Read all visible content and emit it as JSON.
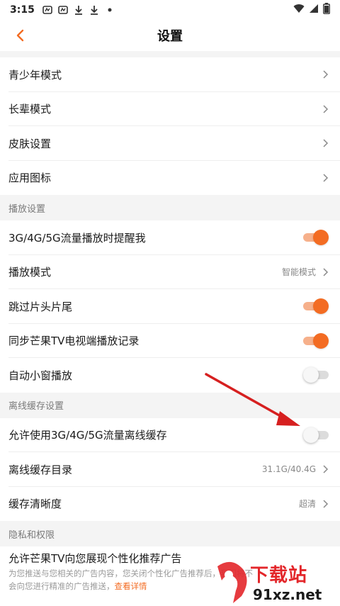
{
  "status_bar": {
    "time": "3:15",
    "icons": [
      "notification-a-icon",
      "notification-b-icon",
      "download-icon",
      "download-icon",
      "dot-icon"
    ],
    "right_icons": [
      "wifi-icon",
      "signal-icon",
      "battery-icon"
    ]
  },
  "navbar": {
    "title": "设置",
    "back_icon": "chevron-left-icon"
  },
  "group1": [
    {
      "label": "青少年模式"
    },
    {
      "label": "长辈模式"
    },
    {
      "label": "皮肤设置"
    },
    {
      "label": "应用图标"
    }
  ],
  "playback": {
    "header": "播放设置",
    "items": [
      {
        "label": "3G/4G/5G流量播放时提醒我",
        "toggle": true
      },
      {
        "label": "播放模式",
        "value": "智能模式"
      },
      {
        "label": "跳过片头片尾",
        "toggle": true
      },
      {
        "label": "同步芒果TV电视端播放记录",
        "toggle": true
      },
      {
        "label": "自动小窗播放",
        "toggle": false
      }
    ]
  },
  "offline": {
    "header": "离线缓存设置",
    "items": [
      {
        "label": "允许使用3G/4G/5G流量离线缓存",
        "toggle": false
      },
      {
        "label": "离线缓存目录",
        "value": "31.1G/40.4G"
      },
      {
        "label": "缓存清晰度",
        "value": "超清"
      }
    ]
  },
  "privacy": {
    "header": "隐私和权限",
    "ad": {
      "label": "允许芒果TV向您展现个性化推荐广告",
      "desc_line1": "为您推送与您相关的广告内容，您关闭个性化广告推荐后，我们将不",
      "desc_line2": "会向您进行精准的广告推送，",
      "link": "查看详情"
    }
  },
  "watermark": {
    "text": "下载站",
    "domain": "91xz.net"
  },
  "colors": {
    "accent": "#f36c23",
    "annotation_arrow": "#d62020"
  }
}
